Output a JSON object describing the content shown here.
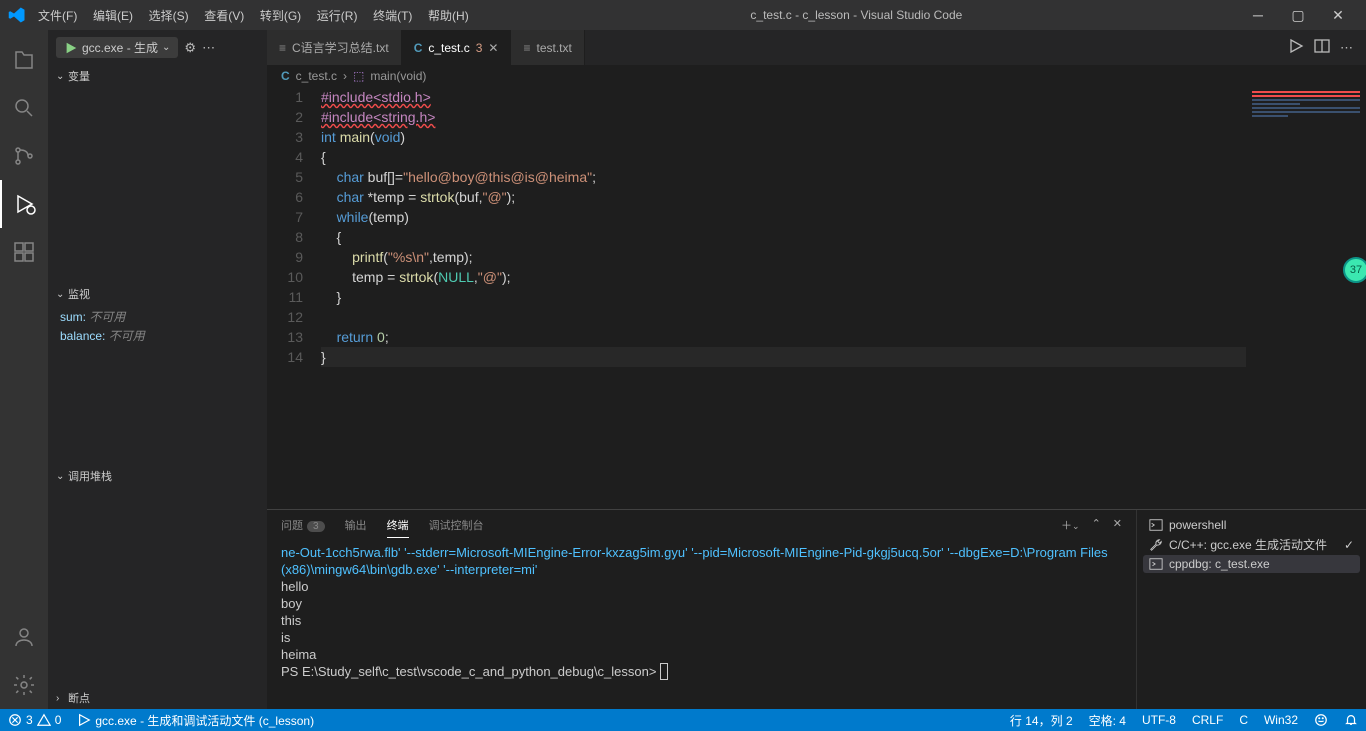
{
  "titlebar": {
    "title": "c_test.c - c_lesson - Visual Studio Code",
    "menu": [
      "文件(F)",
      "编辑(E)",
      "选择(S)",
      "查看(V)",
      "转到(G)",
      "运行(R)",
      "终端(T)",
      "帮助(H)"
    ]
  },
  "runcfg": {
    "label": "gcc.exe - 生成"
  },
  "sidebar": {
    "sections": {
      "vars": "变量",
      "watch": "监视",
      "callstack": "调用堆栈",
      "breakpoints": "断点"
    },
    "watch": [
      {
        "key": "sum:",
        "val": "不可用"
      },
      {
        "key": "balance:",
        "val": "不可用"
      }
    ]
  },
  "tabs": [
    {
      "icon": "txt",
      "label": "C语言学习总结.txt",
      "active": false,
      "dirty": false
    },
    {
      "icon": "c",
      "label": "c_test.c",
      "active": true,
      "dirty": true,
      "dirtyCount": "3"
    },
    {
      "icon": "txt",
      "label": "test.txt",
      "active": false,
      "dirty": false
    }
  ],
  "breadcrumb": {
    "file": "c_test.c",
    "symbol": "main(void)"
  },
  "code": {
    "lines": [
      {
        "n": 1,
        "html": "<span class='tok-pp tok-wavy'>#include&lt;stdio.h&gt;</span>"
      },
      {
        "n": 2,
        "html": "<span class='tok-pp tok-wavy'>#include&lt;string.h&gt;</span>"
      },
      {
        "n": 3,
        "html": "<span class='tok-kw'>int</span> <span class='tok-fn'>main</span>(<span class='tok-kw'>void</span>)"
      },
      {
        "n": 4,
        "html": "{"
      },
      {
        "n": 5,
        "html": "    <span class='tok-kw'>char</span> buf[]=<span class='tok-str'>\"hello@boy@this@is@heima\"</span>;"
      },
      {
        "n": 6,
        "html": "    <span class='tok-kw'>char</span> *temp = <span class='tok-fn'>strtok</span>(buf,<span class='tok-str'>\"@\"</span>);"
      },
      {
        "n": 7,
        "html": "    <span class='tok-kw'>while</span>(temp)"
      },
      {
        "n": 8,
        "html": "    {"
      },
      {
        "n": 9,
        "html": "        <span class='tok-fn'>printf</span>(<span class='tok-str'>\"%s\\n\"</span>,temp);"
      },
      {
        "n": 10,
        "html": "        temp = <span class='tok-fn'>strtok</span>(<span class='tok-macro'>NULL</span>,<span class='tok-str'>\"@\"</span>);"
      },
      {
        "n": 11,
        "html": "    }"
      },
      {
        "n": 12,
        "html": ""
      },
      {
        "n": 13,
        "html": "    <span class='tok-kw'>return</span> <span class='tok-num'>0</span>;"
      },
      {
        "n": 14,
        "html": "}",
        "active": true
      }
    ]
  },
  "panel": {
    "tabs": {
      "problems": "问题",
      "problemsBadge": "3",
      "output": "输出",
      "terminal": "终端",
      "debug": "调试控制台"
    },
    "terminal": {
      "args": "ne-Out-1cch5rwa.flb' '--stderr=Microsoft-MIEngine-Error-kxzag5im.gyu' '--pid=Microsoft-MIEngine-Pid-gkgj5ucq.5or' '--dbgExe=D:\\Program Files (x86)\\mingw64\\bin\\gdb.exe' '--interpreter=mi'",
      "out": [
        "hello",
        "boy",
        "this",
        "is",
        "heima"
      ],
      "prompt": "PS E:\\Study_self\\c_test\\vscode_c_and_python_debug\\c_lesson> "
    },
    "termlist": [
      {
        "icon": "ps",
        "label": "powershell",
        "sel": false
      },
      {
        "icon": "wrench",
        "label": "C/C++: gcc.exe 生成活动文件",
        "sel": false,
        "check": true
      },
      {
        "icon": "debug",
        "label": "cppdbg: c_test.exe",
        "sel": true
      }
    ]
  },
  "statusbar": {
    "errors": "3",
    "warnings": "0",
    "launch": "gcc.exe - 生成和调试活动文件 (c_lesson)",
    "lncol": "行 14，列 2",
    "spaces": "空格: 4",
    "encoding": "UTF-8",
    "eol": "CRLF",
    "lang": "C",
    "win": "Win32"
  },
  "badge": "37"
}
